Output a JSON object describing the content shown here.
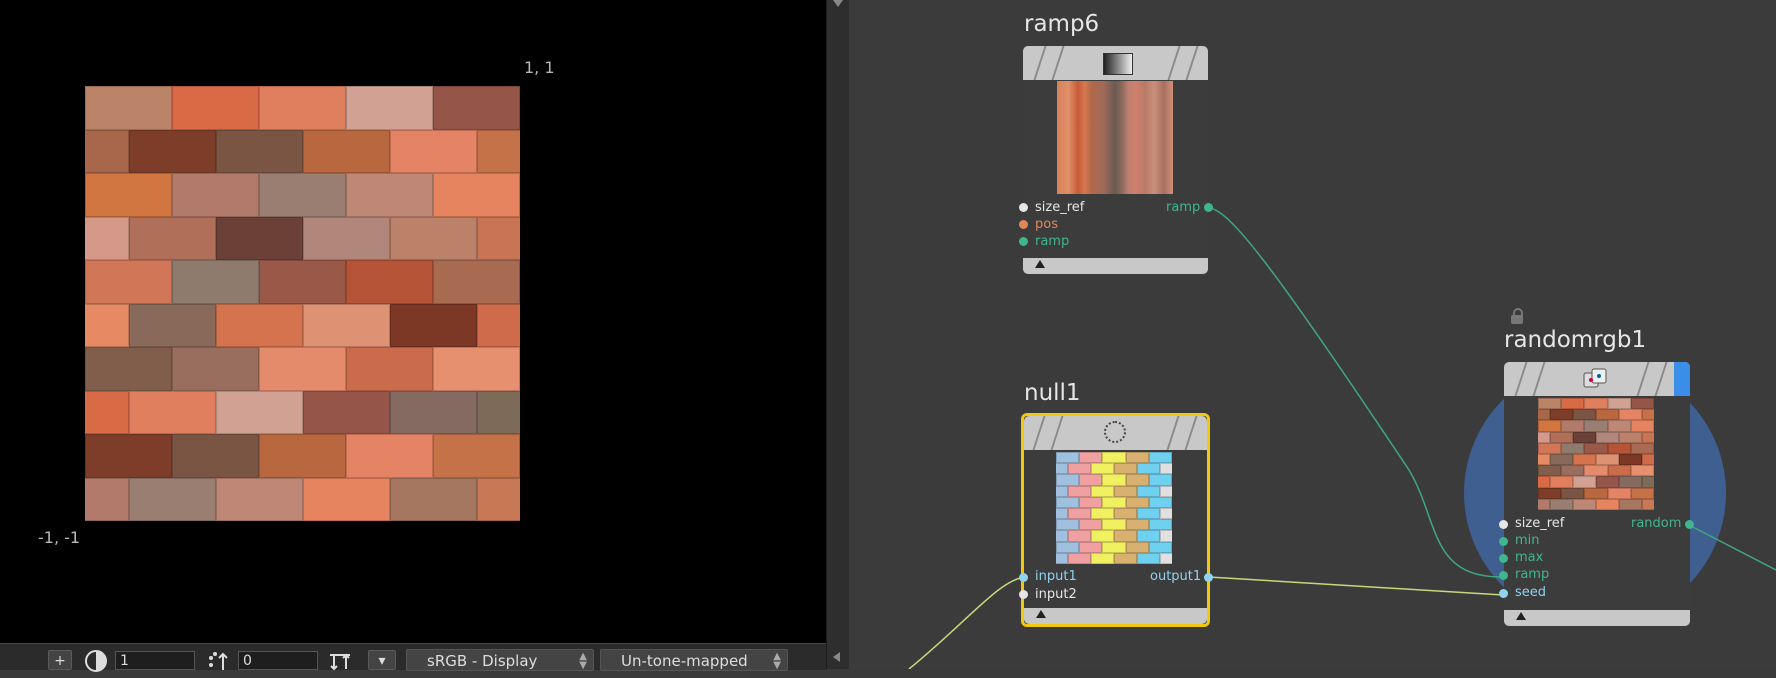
{
  "viewer": {
    "coord_top_right": "1, 1",
    "coord_bottom_left": "-1, -1",
    "texture_colors": [
      "#c97855",
      "#b37560",
      "#bd8168",
      "#cf7458",
      "#b85a3c",
      "#905c4e",
      "#c99385",
      "#bb8469",
      "#a8664b",
      "#d17541",
      "#d5998a",
      "#d27658",
      "#e68a63",
      "#805e4b",
      "#d86a45",
      "#7e3d29",
      "#b27a6a",
      "#b06f58",
      "#8e7b6e",
      "#89695a",
      "#9a6e5f",
      "#e07f5e",
      "#7a5544",
      "#9a7e72",
      "#6b4036",
      "#995848",
      "#d4734e",
      "#e48b6c",
      "#d1a194",
      "#b8673e",
      "#bf8876",
      "#b0877a",
      "#b55436",
      "#dc9273",
      "#ca6c4c",
      "#955548",
      "#e48465",
      "#e6845f",
      "#bc8269",
      "#a86a51",
      "#7c3824",
      "#e69070",
      "#856a62",
      "#c57248",
      "#a67760",
      "#c97455",
      "#bf8f7e",
      "#cf6b4b",
      "#b16c5e",
      "#7d6a58",
      "#b08674"
    ]
  },
  "bottom_bar": {
    "add_label": "+",
    "field1_value": "1",
    "field2_value": "0",
    "colorspace_label": "sRGB - Display",
    "tonemap_label": "Un-tone-mapped"
  },
  "nodes": {
    "ramp6": {
      "title": "ramp6",
      "inputs": [
        "size_ref",
        "pos",
        "ramp"
      ],
      "outputs": [
        "ramp"
      ]
    },
    "null1": {
      "title": "null1",
      "inputs": [
        "input1",
        "input2"
      ],
      "outputs": [
        "output1"
      ]
    },
    "randomrgb1": {
      "title": "randomrgb1",
      "inputs": [
        "size_ref",
        "min",
        "max",
        "ramp",
        "seed"
      ],
      "outputs": [
        "random"
      ]
    }
  },
  "colors": {
    "port_white": "#e6e6e6",
    "port_orange": "#e0875a",
    "port_green": "#3fb68f",
    "port_blue": "#8fd3f0",
    "selected_border": "#f0c810",
    "wire_green": "#3fa77f",
    "wire_yellow": "#c6d97a",
    "randomrgb_circle": "#3e5f8f"
  }
}
